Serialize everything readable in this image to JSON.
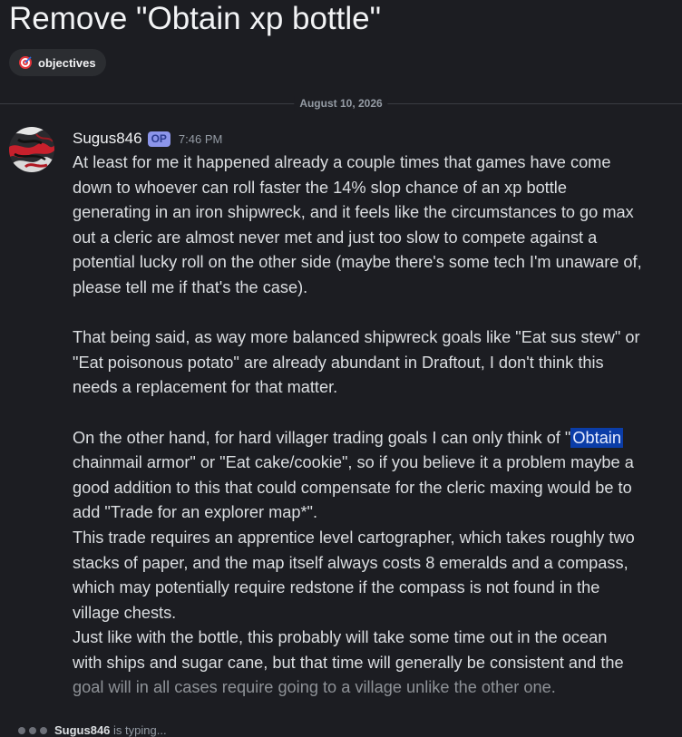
{
  "thread": {
    "title": "Remove \"Obtain xp bottle\"",
    "tag": "objectives"
  },
  "date_divider": "August 10, 2026",
  "message": {
    "author": "Sugus846",
    "badge": "OP",
    "time": "7:46 PM",
    "lines": [
      "At least for me it happened already a couple times that games have come",
      "down to whoever can roll faster the 14% slop chance of an xp bottle",
      "generating in an iron shipwreck, and it feels like the circumstances to go max",
      "out a cleric are almost never met and just too slow to compete against a",
      "potential lucky roll on the other side (maybe there's some tech I'm unaware of,",
      "please tell me if that's the case).",
      "",
      "That being said, as way more balanced shipwreck goals like \"Eat sus stew\" or",
      "\"Eat poisonous potato\" are already abundant in Draftout, I don't think this",
      "needs a replacement for that matter.",
      "",
      "On the other hand, for hard villager trading goals I can only think of \"",
      "chainmail armor\" or \"Eat cake/cookie\", so if you believe it a problem maybe a",
      "good addition to this that could compensate for the cleric maxing would be to",
      "add \"Trade for an explorer map*\".",
      "This trade requires an apprentice level cartographer, which takes roughly two",
      "stacks of paper, and the map itself always costs 8 emeralds and a compass,",
      "which may potentially require redstone if the compass is not found in the",
      "village chests.",
      "Just like with the bottle, this probably will take some time out in the ocean",
      "with ships and sugar cane, but that time will generally be consistent and the",
      "goal will in all cases require going to a village unlike the other one."
    ],
    "highlighted_word": "Obtain"
  },
  "typing": {
    "user": "Sugus846",
    "text": " is typing..."
  },
  "colors": {
    "background": "#1c1d22",
    "text": "#dbdee1",
    "muted": "#949ba4",
    "selection": "#0b3da8",
    "tag_icon": "#e3343a"
  },
  "icons": {
    "tag": "target-icon",
    "avatar": "marble-avatar"
  }
}
